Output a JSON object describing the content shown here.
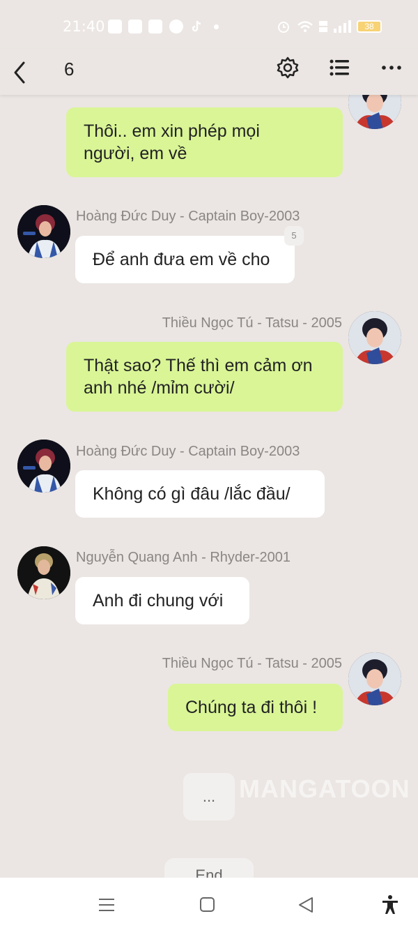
{
  "status_bar": {
    "time": "21:40",
    "battery": "38"
  },
  "nav": {
    "title": "6",
    "icons": [
      "back-arrow-icon",
      "gear-icon",
      "list-icon",
      "more-dots-icon"
    ]
  },
  "messages": [
    {
      "side": "right",
      "sender": "",
      "text": "Thôi.. em xin phép mọi\nngười, em về"
    },
    {
      "side": "left",
      "sender": "Hoàng Đức Duy - Captain Boy-2003",
      "text": "Để anh đưa em về cho",
      "badge": "5"
    },
    {
      "side": "right",
      "sender": "Thiều Ngọc Tú - Tatsu - 2005",
      "text": "Thật sao? Thế thì em cảm ơn\nanh nhé /mỉm cười/"
    },
    {
      "side": "left",
      "sender": "Hoàng Đức Duy - Captain Boy-2003",
      "text": "Không có gì đâu /lắc đầu/"
    },
    {
      "side": "left",
      "sender": "Nguyễn Quang Anh - Rhyder-2001",
      "text": "Anh đi chung với"
    },
    {
      "side": "right",
      "sender": "Thiều Ngọc Tú - Tatsu - 2005",
      "text": "Chúng ta đi thôi !"
    }
  ],
  "typing_indicator": "...",
  "watermark": "MANGATOON",
  "end_pill": "End",
  "colors": {
    "background": "#ebe6e3",
    "my_bubble": "#d9f596",
    "other_bubble": "#ffffff",
    "name_text": "#8a8685"
  }
}
